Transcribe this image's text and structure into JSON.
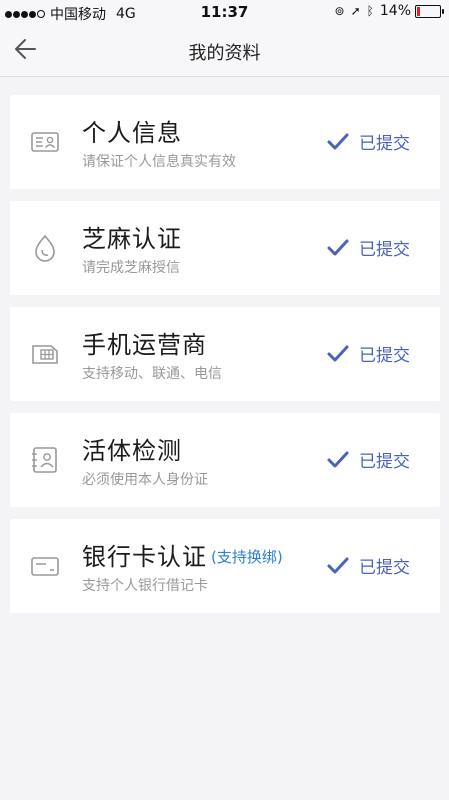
{
  "status_bar": {
    "carrier": "中国移动",
    "network": "4G",
    "time": "11:37",
    "battery": "14%",
    "battery_level": 0.14
  },
  "header": {
    "title": "我的资料"
  },
  "colors": {
    "accent": "#4a62b8",
    "link": "#2a7fd9",
    "battery_low": "#e2231a"
  },
  "items": [
    {
      "icon": "id-card-icon",
      "title": "个人信息",
      "tag": "",
      "subtitle": "请保证个人信息真实有效",
      "status": "已提交"
    },
    {
      "icon": "drop-icon",
      "title": "芝麻认证",
      "tag": "",
      "subtitle": "请完成芝麻授信",
      "status": "已提交"
    },
    {
      "icon": "sim-card-icon",
      "title": "手机运营商",
      "tag": "",
      "subtitle": "支持移动、联通、电信",
      "status": "已提交"
    },
    {
      "icon": "face-scan-icon",
      "title": "活体检测",
      "tag": "",
      "subtitle": "必须使用本人身份证",
      "status": "已提交"
    },
    {
      "icon": "bank-card-icon",
      "title": "银行卡认证",
      "tag": "(支持换绑)",
      "subtitle": "支持个人银行借记卡",
      "status": "已提交"
    }
  ]
}
